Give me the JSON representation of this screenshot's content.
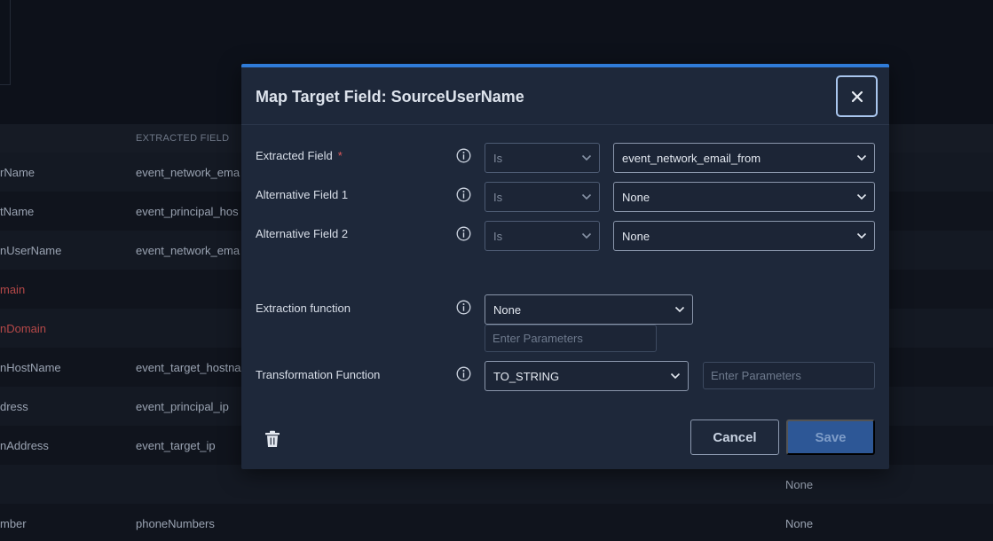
{
  "background_table": {
    "header_label": "EXTRACTED FIELD",
    "rows": [
      {
        "c1": "rName",
        "c2": "event_network_ema",
        "c3": ""
      },
      {
        "c1": "tName",
        "c2": "event_principal_hos",
        "c3": ""
      },
      {
        "c1": "nUserName",
        "c2": "event_network_ema",
        "c3": ""
      },
      {
        "c1": "main",
        "c2": "",
        "c3": ""
      },
      {
        "c1": "nDomain",
        "c2": "",
        "c3": ""
      },
      {
        "c1": "nHostName",
        "c2": "event_target_hostna",
        "c3": ""
      },
      {
        "c1": "dress",
        "c2": "event_principal_ip",
        "c3": ""
      },
      {
        "c1": "nAddress",
        "c2": "event_target_ip",
        "c3": ""
      },
      {
        "c1": "",
        "c2": "",
        "c3": "None"
      },
      {
        "c1": "mber",
        "c2": "phoneNumbers",
        "c3": "None"
      }
    ]
  },
  "modal": {
    "title": "Map Target Field: SourceUserName",
    "fields": {
      "extracted": {
        "label": "Extracted Field",
        "required_mark": "*",
        "operator": "Is",
        "value": "event_network_email_from"
      },
      "alt1": {
        "label": "Alternative Field 1",
        "operator": "Is",
        "value": "None"
      },
      "alt2": {
        "label": "Alternative Field 2",
        "operator": "Is",
        "value": "None"
      },
      "extraction_function": {
        "label": "Extraction function",
        "value": "None",
        "params_placeholder": "Enter Parameters"
      },
      "transformation_function": {
        "label": "Transformation Function",
        "value": "TO_STRING",
        "params_placeholder": "Enter Parameters"
      }
    },
    "buttons": {
      "cancel": "Cancel",
      "save": "Save"
    }
  },
  "icons": {
    "close": "close-icon",
    "info": "info-icon",
    "chevron": "chevron-down-icon",
    "delete": "trash-icon"
  },
  "colors": {
    "accent": "#2f7bd8",
    "primary_button": "#2d5796",
    "required": "#e05a5a",
    "error_text": "#b54848"
  }
}
